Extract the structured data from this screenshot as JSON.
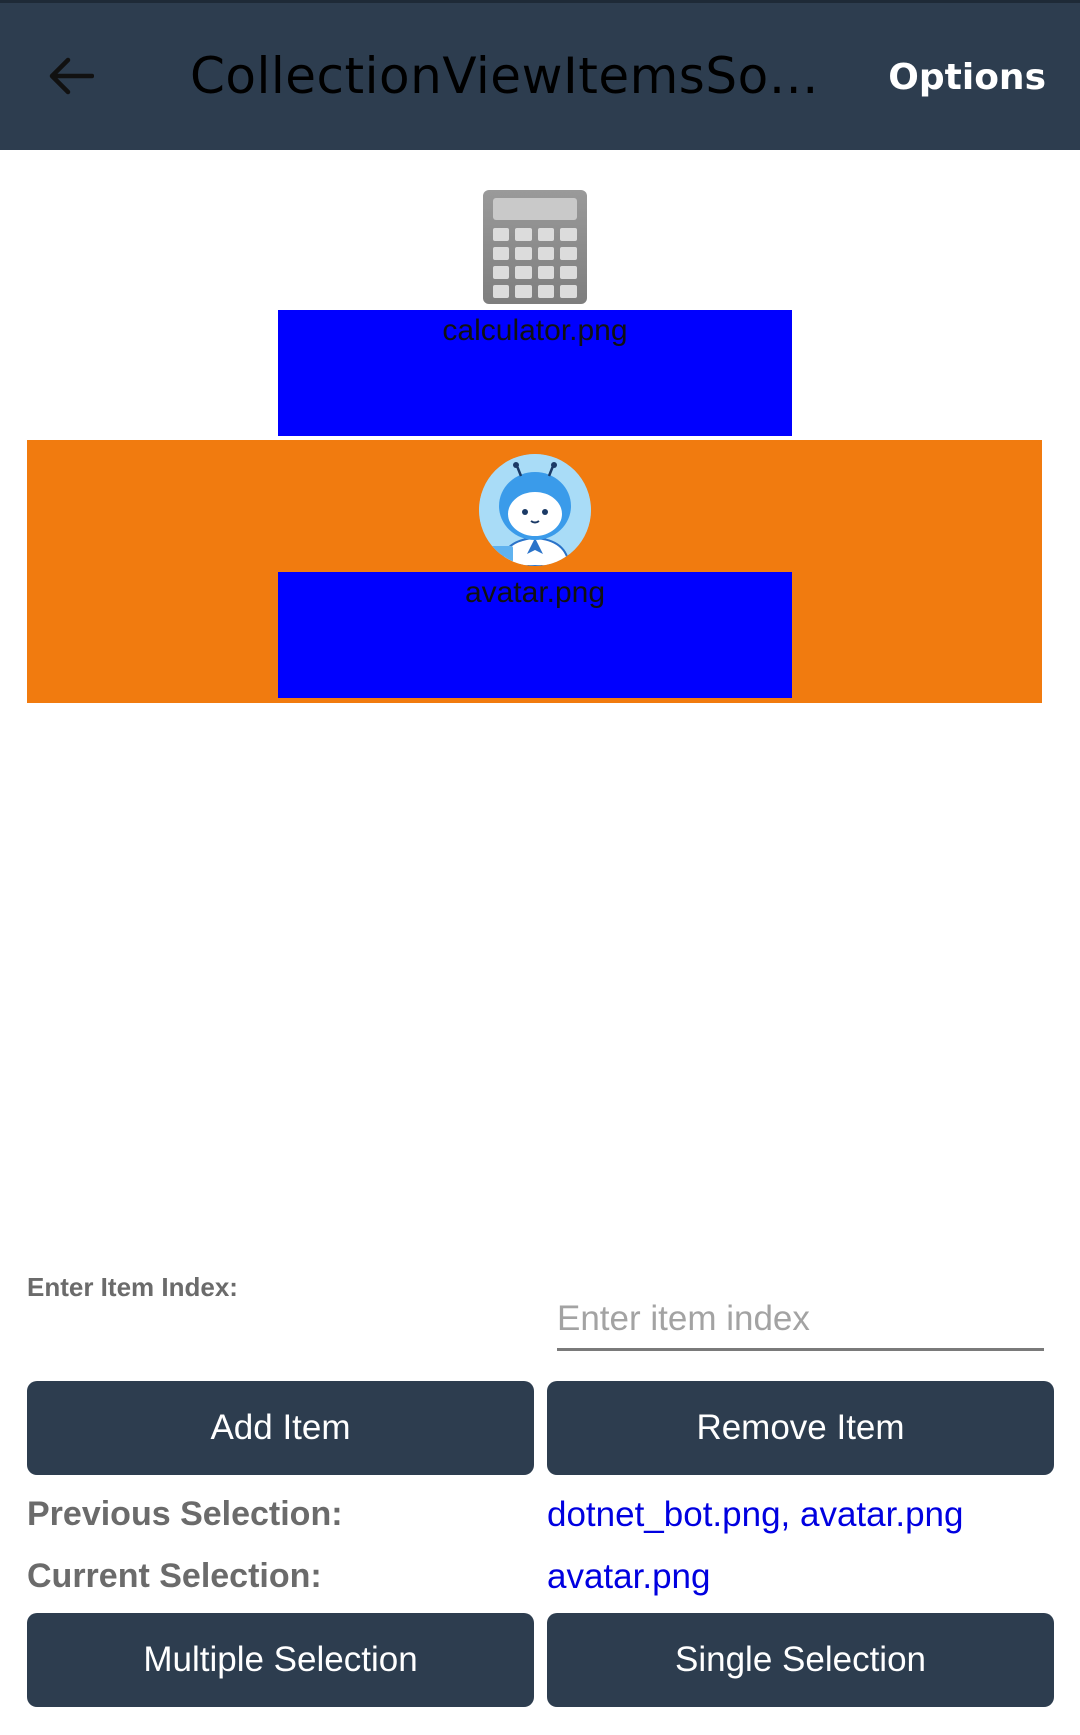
{
  "appbar": {
    "title": "CollectionViewItemsSour…",
    "options_label": "Options",
    "background": "#2d3d4f"
  },
  "items": [
    {
      "label": "calculator.png",
      "icon": "calculator-icon",
      "selected": false
    },
    {
      "label": "avatar.png",
      "icon": "avatar-image",
      "selected": true
    }
  ],
  "colors": {
    "label_background": "#0000ff",
    "selected_background": "#f17b0f",
    "button_background": "#2d3d4f",
    "selection_value": "#0000e0"
  },
  "controls": {
    "index_label": "Enter Item Index:",
    "index_placeholder": "Enter item index",
    "add_item": "Add Item",
    "remove_item": "Remove Item",
    "previous_selection_label": "Previous Selection:",
    "previous_selection_value": "dotnet_bot.png, avatar.png",
    "current_selection_label": "Current Selection:",
    "current_selection_value": "avatar.png",
    "multiple_selection": "Multiple Selection",
    "single_selection": "Single Selection"
  }
}
